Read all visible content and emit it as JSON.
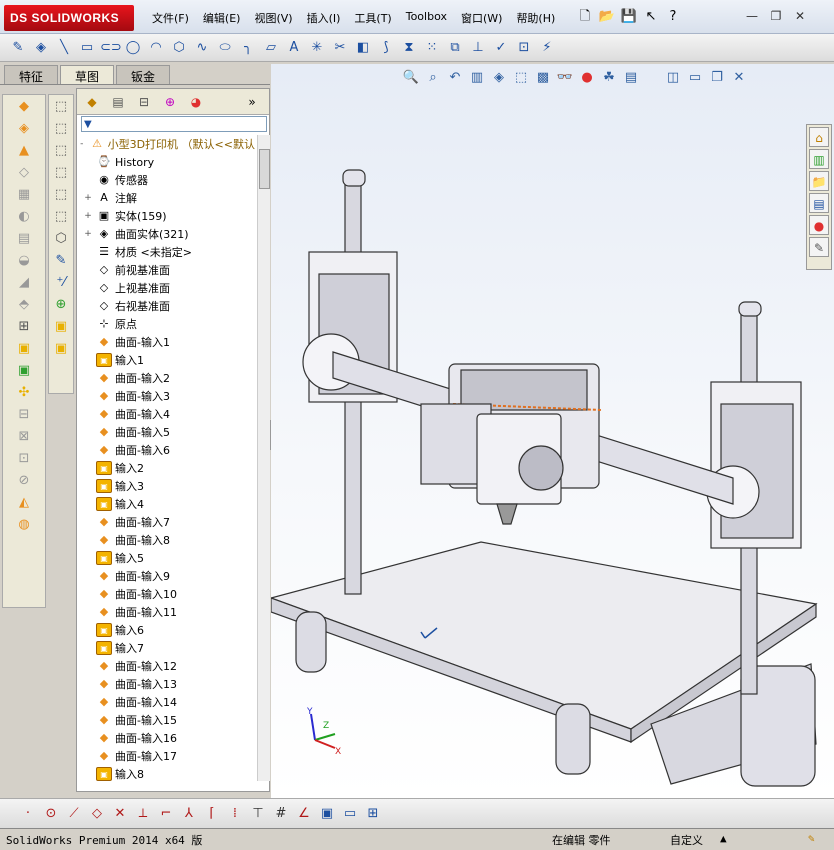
{
  "app": {
    "logo_text": "SOLIDWORKS",
    "logo_prefix": "DS"
  },
  "menu": [
    {
      "label": "文件(F)"
    },
    {
      "label": "编辑(E)"
    },
    {
      "label": "视图(V)"
    },
    {
      "label": "插入(I)"
    },
    {
      "label": "工具(T)"
    },
    {
      "label": "Toolbox"
    },
    {
      "label": "窗口(W)"
    },
    {
      "label": "帮助(H)"
    }
  ],
  "quick_access": [
    "new-icon",
    "open-icon",
    "save-icon",
    "pointer-icon",
    "help-icon"
  ],
  "window_buttons": {
    "minimize": "—",
    "restore": "❐",
    "close": "✕"
  },
  "tabs": [
    {
      "label": "特征"
    },
    {
      "label": "草图"
    },
    {
      "label": "钣金"
    }
  ],
  "active_tab": "草图",
  "tree": {
    "root": "小型3D打印机 （默认<<默认",
    "items": [
      {
        "label": "History",
        "icon": "history-icon",
        "exp": ""
      },
      {
        "label": "传感器",
        "icon": "sensor-icon",
        "exp": ""
      },
      {
        "label": "注解",
        "icon": "annotation-icon",
        "exp": "+"
      },
      {
        "label": "实体(159)",
        "icon": "solid-bodies-icon",
        "exp": "+"
      },
      {
        "label": "曲面实体(321)",
        "icon": "surface-bodies-icon",
        "exp": "+"
      },
      {
        "label": "材质 <未指定>",
        "icon": "material-icon",
        "exp": ""
      },
      {
        "label": "前视基准面",
        "icon": "plane-icon",
        "exp": ""
      },
      {
        "label": "上视基准面",
        "icon": "plane-icon",
        "exp": ""
      },
      {
        "label": "右视基准面",
        "icon": "plane-icon",
        "exp": ""
      },
      {
        "label": "原点",
        "icon": "origin-icon",
        "exp": ""
      },
      {
        "label": "曲面-输入1",
        "icon": "surface-icon",
        "exp": ""
      },
      {
        "label": "输入1",
        "icon": "import-icon",
        "exp": ""
      },
      {
        "label": "曲面-输入2",
        "icon": "surface-icon",
        "exp": ""
      },
      {
        "label": "曲面-输入3",
        "icon": "surface-icon",
        "exp": ""
      },
      {
        "label": "曲面-输入4",
        "icon": "surface-icon",
        "exp": ""
      },
      {
        "label": "曲面-输入5",
        "icon": "surface-icon",
        "exp": ""
      },
      {
        "label": "曲面-输入6",
        "icon": "surface-icon",
        "exp": ""
      },
      {
        "label": "输入2",
        "icon": "import-icon",
        "exp": ""
      },
      {
        "label": "输入3",
        "icon": "import-icon",
        "exp": ""
      },
      {
        "label": "输入4",
        "icon": "import-icon",
        "exp": ""
      },
      {
        "label": "曲面-输入7",
        "icon": "surface-icon",
        "exp": ""
      },
      {
        "label": "曲面-输入8",
        "icon": "surface-icon",
        "exp": ""
      },
      {
        "label": "输入5",
        "icon": "import-icon",
        "exp": ""
      },
      {
        "label": "曲面-输入9",
        "icon": "surface-icon",
        "exp": ""
      },
      {
        "label": "曲面-输入10",
        "icon": "surface-icon",
        "exp": ""
      },
      {
        "label": "曲面-输入11",
        "icon": "surface-icon",
        "exp": ""
      },
      {
        "label": "输入6",
        "icon": "import-icon",
        "exp": ""
      },
      {
        "label": "输入7",
        "icon": "import-icon",
        "exp": ""
      },
      {
        "label": "曲面-输入12",
        "icon": "surface-icon",
        "exp": ""
      },
      {
        "label": "曲面-输入13",
        "icon": "surface-icon",
        "exp": ""
      },
      {
        "label": "曲面-输入14",
        "icon": "surface-icon",
        "exp": ""
      },
      {
        "label": "曲面-输入15",
        "icon": "surface-icon",
        "exp": ""
      },
      {
        "label": "曲面-输入16",
        "icon": "surface-icon",
        "exp": ""
      },
      {
        "label": "曲面-输入17",
        "icon": "surface-icon",
        "exp": ""
      },
      {
        "label": "输入8",
        "icon": "import-icon",
        "exp": ""
      }
    ]
  },
  "triad": {
    "x": "X",
    "y": "Y",
    "z": "Z"
  },
  "status": {
    "product": "SolidWorks Premium 2014 x64 版",
    "mode": "在编辑 零件",
    "custom": "自定义"
  },
  "colors": {
    "accent": "#1c4fa0",
    "logo": "#c8101a",
    "feature_icon": "#f4b400"
  }
}
